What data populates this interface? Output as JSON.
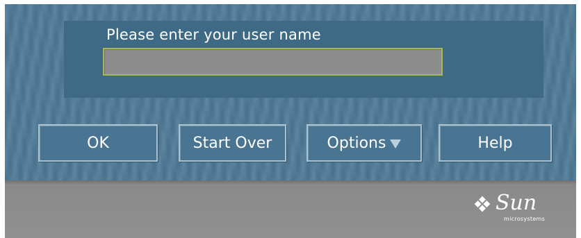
{
  "login": {
    "prompt": "Please enter your user name",
    "username_value": ""
  },
  "buttons": {
    "ok": "OK",
    "start_over": "Start Over",
    "options": "Options",
    "help": "Help"
  },
  "branding": {
    "logo_word": "Sun",
    "logo_subtitle": "microsystems"
  },
  "icons": {
    "options_menu": "triangle-down-icon",
    "logo": "sun-logo-icon"
  },
  "colors": {
    "panel_blue": "#4c7793",
    "inner_blue": "#3f6a86",
    "input_gray": "#8d8d8d",
    "input_border": "#a6b85a",
    "bottom_gray": "#8e8e8e",
    "text_white": "#ffffff"
  }
}
